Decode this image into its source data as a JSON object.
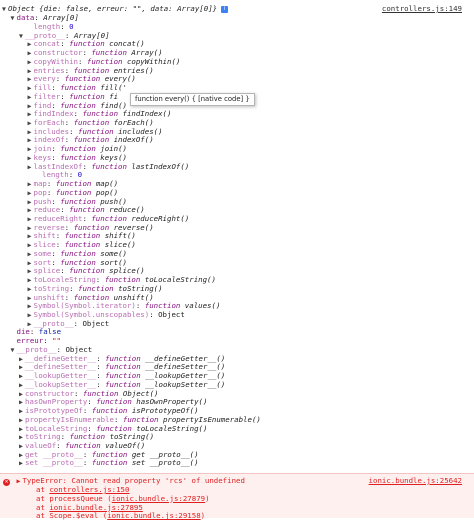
{
  "header": {
    "summary": "Object {die: false, erreur: \"\", data: Array[0]}",
    "info_glyph": "i",
    "source_link": "controllers.js:149"
  },
  "tree_lines": [
    {
      "indent": 1,
      "toggle": "open",
      "k": "data",
      "sep": ": ",
      "v": "Array[0]",
      "vt": "obj"
    },
    {
      "indent": 3,
      "toggle": "none",
      "k": "length",
      "sep": ": ",
      "v": "0",
      "vt": "num",
      "dim": true
    },
    {
      "indent": 2,
      "toggle": "open",
      "k": "__proto__",
      "sep": ": ",
      "v": "Array[0]",
      "vt": "obj",
      "dim": true
    },
    {
      "indent": 3,
      "toggle": "closed",
      "k": "concat",
      "sep": ": ",
      "fk": "function",
      "v": "concat()",
      "dim": true
    },
    {
      "indent": 3,
      "toggle": "closed",
      "k": "constructor",
      "sep": ": ",
      "fk": "function",
      "v": "Array()",
      "dim": true
    },
    {
      "indent": 3,
      "toggle": "closed",
      "k": "copyWithin",
      "sep": ": ",
      "fk": "function",
      "v": "copyWithin()",
      "dim": true
    },
    {
      "indent": 3,
      "toggle": "closed",
      "k": "entries",
      "sep": ": ",
      "fk": "function",
      "v": "entries()",
      "dim": true
    },
    {
      "indent": 3,
      "toggle": "closed",
      "k": "every",
      "sep": ": ",
      "fk": "function",
      "v": "every()",
      "dim": true
    },
    {
      "indent": 3,
      "toggle": "closed",
      "k": "fill",
      "sep": ": ",
      "fk": "function",
      "v": "fill('",
      "dim": true
    },
    {
      "indent": 3,
      "toggle": "closed",
      "k": "filter",
      "sep": ": ",
      "fk": "function",
      "v": "fi",
      "dim": true
    },
    {
      "indent": 3,
      "toggle": "closed",
      "k": "find",
      "sep": ": ",
      "fk": "function",
      "v": "find()",
      "dim": true
    },
    {
      "indent": 3,
      "toggle": "closed",
      "k": "findIndex",
      "sep": ": ",
      "fk": "function",
      "v": "findIndex()",
      "dim": true
    },
    {
      "indent": 3,
      "toggle": "closed",
      "k": "forEach",
      "sep": ": ",
      "fk": "function",
      "v": "forEach()",
      "dim": true
    },
    {
      "indent": 3,
      "toggle": "closed",
      "k": "includes",
      "sep": ": ",
      "fk": "function",
      "v": "includes()",
      "dim": true
    },
    {
      "indent": 3,
      "toggle": "closed",
      "k": "indexOf",
      "sep": ": ",
      "fk": "function",
      "v": "indexOf()",
      "dim": true
    },
    {
      "indent": 3,
      "toggle": "closed",
      "k": "join",
      "sep": ": ",
      "fk": "function",
      "v": "join()",
      "dim": true
    },
    {
      "indent": 3,
      "toggle": "closed",
      "k": "keys",
      "sep": ": ",
      "fk": "function",
      "v": "keys()",
      "dim": true
    },
    {
      "indent": 3,
      "toggle": "closed",
      "k": "lastIndexOf",
      "sep": ": ",
      "fk": "function",
      "v": "lastIndexOf()",
      "dim": true
    },
    {
      "indent": 4,
      "toggle": "none",
      "k": "length",
      "sep": ": ",
      "v": "0",
      "vt": "num",
      "dim": true
    },
    {
      "indent": 3,
      "toggle": "closed",
      "k": "map",
      "sep": ": ",
      "fk": "function",
      "v": "map()",
      "dim": true
    },
    {
      "indent": 3,
      "toggle": "closed",
      "k": "pop",
      "sep": ": ",
      "fk": "function",
      "v": "pop()",
      "dim": true
    },
    {
      "indent": 3,
      "toggle": "closed",
      "k": "push",
      "sep": ": ",
      "fk": "function",
      "v": "push()",
      "dim": true
    },
    {
      "indent": 3,
      "toggle": "closed",
      "k": "reduce",
      "sep": ": ",
      "fk": "function",
      "v": "reduce()",
      "dim": true
    },
    {
      "indent": 3,
      "toggle": "closed",
      "k": "reduceRight",
      "sep": ": ",
      "fk": "function",
      "v": "reduceRight()",
      "dim": true
    },
    {
      "indent": 3,
      "toggle": "closed",
      "k": "reverse",
      "sep": ": ",
      "fk": "function",
      "v": "reverse()",
      "dim": true
    },
    {
      "indent": 3,
      "toggle": "closed",
      "k": "shift",
      "sep": ": ",
      "fk": "function",
      "v": "shift()",
      "dim": true
    },
    {
      "indent": 3,
      "toggle": "closed",
      "k": "slice",
      "sep": ": ",
      "fk": "function",
      "v": "slice()",
      "dim": true
    },
    {
      "indent": 3,
      "toggle": "closed",
      "k": "some",
      "sep": ": ",
      "fk": "function",
      "v": "some()",
      "dim": true
    },
    {
      "indent": 3,
      "toggle": "closed",
      "k": "sort",
      "sep": ": ",
      "fk": "function",
      "v": "sort()",
      "dim": true
    },
    {
      "indent": 3,
      "toggle": "closed",
      "k": "splice",
      "sep": ": ",
      "fk": "function",
      "v": "splice()",
      "dim": true
    },
    {
      "indent": 3,
      "toggle": "closed",
      "k": "toLocaleString",
      "sep": ": ",
      "fk": "function",
      "v": "toLocaleString()",
      "dim": true
    },
    {
      "indent": 3,
      "toggle": "closed",
      "k": "toString",
      "sep": ": ",
      "fk": "function",
      "v": "toString()",
      "dim": true
    },
    {
      "indent": 3,
      "toggle": "closed",
      "k": "unshift",
      "sep": ": ",
      "fk": "function",
      "v": "unshift()",
      "dim": true
    },
    {
      "indent": 3,
      "toggle": "closed",
      "k": "Symbol(Symbol.iterator)",
      "sep": ": ",
      "fk": "function",
      "v": "values()",
      "dim": true
    },
    {
      "indent": 3,
      "toggle": "closed",
      "k": "Symbol(Symbol.unscopables)",
      "sep": ": ",
      "v": "Object",
      "vt": "plain",
      "dim": true
    },
    {
      "indent": 3,
      "toggle": "closed",
      "k": "__proto__",
      "sep": ": ",
      "v": "Object",
      "vt": "plain",
      "dim": true
    },
    {
      "indent": 1,
      "toggle": "none",
      "k": "die",
      "sep": ": ",
      "v": "false",
      "vt": "bool"
    },
    {
      "indent": 1,
      "toggle": "none",
      "k": "erreur",
      "sep": ": ",
      "v": "\"\"",
      "vt": "str"
    },
    {
      "indent": 1,
      "toggle": "open",
      "k": "__proto__",
      "sep": ": ",
      "v": "Object",
      "vt": "plain",
      "dim": true
    },
    {
      "indent": 2,
      "toggle": "closed",
      "k": "__defineGetter__",
      "sep": ": ",
      "fk": "function",
      "v": "__defineGetter__()",
      "dim": true
    },
    {
      "indent": 2,
      "toggle": "closed",
      "k": "__defineSetter__",
      "sep": ": ",
      "fk": "function",
      "v": "__defineSetter__()",
      "dim": true
    },
    {
      "indent": 2,
      "toggle": "closed",
      "k": "__lookupGetter__",
      "sep": ": ",
      "fk": "function",
      "v": "__lookupGetter__()",
      "dim": true
    },
    {
      "indent": 2,
      "toggle": "closed",
      "k": "__lookupSetter__",
      "sep": ": ",
      "fk": "function",
      "v": "__lookupSetter__()",
      "dim": true
    },
    {
      "indent": 2,
      "toggle": "closed",
      "k": "constructor",
      "sep": ": ",
      "fk": "function",
      "v": "Object()",
      "dim": true
    },
    {
      "indent": 2,
      "toggle": "closed",
      "k": "hasOwnProperty",
      "sep": ": ",
      "fk": "function",
      "v": "hasOwnProperty()",
      "dim": true
    },
    {
      "indent": 2,
      "toggle": "closed",
      "k": "isPrototypeOf",
      "sep": ": ",
      "fk": "function",
      "v": "isPrototypeOf()",
      "dim": true
    },
    {
      "indent": 2,
      "toggle": "closed",
      "k": "propertyIsEnumerable",
      "sep": ": ",
      "fk": "function",
      "v": "propertyIsEnumerable()",
      "dim": true
    },
    {
      "indent": 2,
      "toggle": "closed",
      "k": "toLocaleString",
      "sep": ": ",
      "fk": "function",
      "v": "toLocaleString()",
      "dim": true
    },
    {
      "indent": 2,
      "toggle": "closed",
      "k": "toString",
      "sep": ": ",
      "fk": "function",
      "v": "toString()",
      "dim": true
    },
    {
      "indent": 2,
      "toggle": "closed",
      "k": "valueOf",
      "sep": ": ",
      "fk": "function",
      "v": "valueOf()",
      "dim": true
    },
    {
      "indent": 2,
      "toggle": "closed",
      "k": "get __proto__",
      "sep": ": ",
      "fk": "function",
      "v": "get __proto__()",
      "dim": true
    },
    {
      "indent": 2,
      "toggle": "closed",
      "k": "set __proto__",
      "sep": ": ",
      "fk": "function",
      "v": "set __proto__()",
      "dim": true
    }
  ],
  "tooltip": {
    "text": "function every() { [native code] }"
  },
  "error": {
    "icon_glyph": "×",
    "message": "TypeError: Cannot read property 'rcs' of undefined",
    "source_link": "ionic.bundle.js:25642",
    "stack": [
      {
        "prefix": "at ",
        "text": "controllers.js:150"
      },
      {
        "prefix": "at processQueue (",
        "text": "ionic.bundle.js:27879",
        "suffix": ")"
      },
      {
        "prefix": "at ",
        "text": "ionic.bundle.js:27895"
      },
      {
        "prefix": "at Scope.$eval (",
        "text": "ionic.bundle.js:29158",
        "suffix": ")"
      }
    ]
  },
  "colors": {
    "key": "#881280",
    "dim_key": "#b96cb3",
    "number": "#1c00cf",
    "string": "#c41a16",
    "error": "#e02020"
  }
}
